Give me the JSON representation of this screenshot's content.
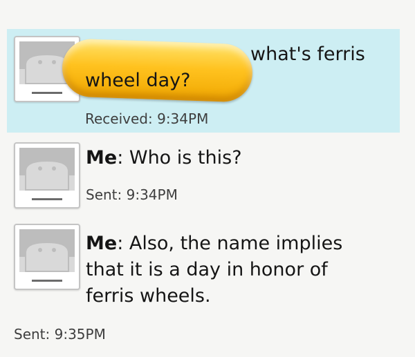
{
  "messages": [
    {
      "direction": "received",
      "sender": "",
      "text_line1": "what's ferris",
      "text_line2": "wheel day?",
      "timestamp": "Received: 9:34PM"
    },
    {
      "direction": "sent",
      "sender": "Me",
      "text": ": Who is this?",
      "timestamp": "Sent: 9:34PM"
    },
    {
      "direction": "sent",
      "sender": "Me",
      "text_line1": ": Also, the name implies",
      "text_line2": "that it is a day in honor of",
      "text_line3": "ferris wheels.",
      "timestamp": "Sent: 9:35PM"
    }
  ],
  "colors": {
    "received_bg": "#cdeef3",
    "page_bg": "#f6f6f4",
    "redaction": "#ffc21f"
  },
  "icons": [
    "android-avatar-icon",
    "redaction-mark"
  ]
}
